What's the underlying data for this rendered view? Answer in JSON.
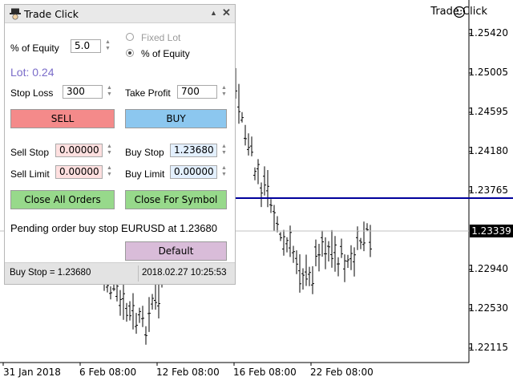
{
  "chart": {
    "title": "Trade Click",
    "smiley_icon": "smiley-face-icon",
    "current_price": "1.23339",
    "price_labels": [
      "1.25420",
      "1.25005",
      "1.24595",
      "1.24180",
      "1.23765",
      "1.22940",
      "1.22530",
      "1.22115"
    ],
    "time_labels": [
      "31 Jan 2018",
      "6 Feb 08:00",
      "12 Feb 08:00",
      "16 Feb 08:00",
      "22 Feb 08:00"
    ],
    "buy_stop_line_color": "#00009c"
  },
  "panel": {
    "title": "Trade Click",
    "equity_label": "% of Equity",
    "equity_value": "5.0",
    "radio_fixed_lot": "Fixed Lot",
    "radio_percent_equity": "% of Equity",
    "lot_text": "Lot: 0.24",
    "stop_loss_label": "Stop Loss",
    "stop_loss_value": "300",
    "take_profit_label": "Take Profit",
    "take_profit_value": "700",
    "sell_button": "SELL",
    "buy_button": "BUY",
    "sell_stop_label": "Sell Stop",
    "sell_stop_value": "0.00000",
    "buy_stop_label": "Buy Stop",
    "buy_stop_value": "1.23680",
    "sell_limit_label": "Sell Limit",
    "sell_limit_value": "0.00000",
    "buy_limit_label": "Buy Limit",
    "buy_limit_value": "0.00000",
    "close_all_button": "Close All Orders",
    "close_symbol_button": "Close For Symbol",
    "message": "Pending order buy stop EURUSD at 1.23680",
    "default_button": "Default",
    "status_left": "Buy Stop = 1.23680",
    "status_right": "2018.02.27 10:25:53"
  }
}
